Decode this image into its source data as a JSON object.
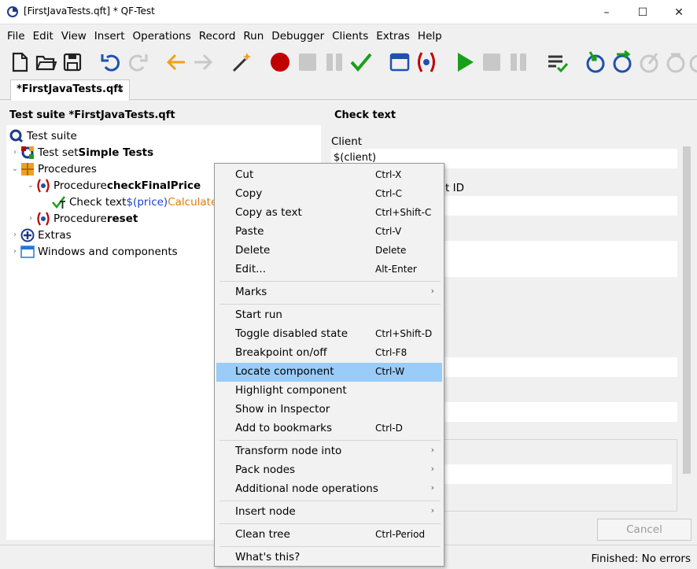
{
  "window": {
    "title": "[FirstJavaTests.qft] * QF-Test",
    "minimize": "–",
    "maximize": "☐",
    "close": "✕"
  },
  "menubar": [
    "File",
    "Edit",
    "View",
    "Insert",
    "Operations",
    "Record",
    "Run",
    "Debugger",
    "Clients",
    "Extras",
    "Help"
  ],
  "tab": {
    "label": "*FirstJavaTests.qft",
    "close": "✕"
  },
  "left_panel": {
    "title": "Test suite *FirstJavaTests.qft",
    "tree": [
      {
        "text": "Test suite",
        "bold": ""
      },
      {
        "text": "Test set ",
        "bold": "Simple Tests"
      },
      {
        "text": "Procedures",
        "bold": ""
      },
      {
        "text": "Procedure ",
        "bold": "checkFinalPrice"
      },
      {
        "text": "Check text ",
        "var": "$(price)",
        "tail": " Calculated"
      },
      {
        "text": "Procedure ",
        "bold": "reset"
      },
      {
        "text": "Extras",
        "bold": ""
      },
      {
        "text": "Windows and components",
        "bold": ""
      }
    ]
  },
  "right_panel": {
    "title": "Check text",
    "client_label": "Client",
    "client_value": "$(client)",
    "component_id_suffix": "t ID",
    "cancel": "Cancel"
  },
  "status": "Finished: No errors",
  "context_menu": [
    {
      "label": "Cut",
      "shortcut": "Ctrl-X"
    },
    {
      "label": "Copy",
      "shortcut": "Ctrl-C"
    },
    {
      "label": "Copy as text",
      "shortcut": "Ctrl+Shift-C"
    },
    {
      "label": "Paste",
      "shortcut": "Ctrl-V"
    },
    {
      "label": "Delete",
      "shortcut": "Delete"
    },
    {
      "label": "Edit...",
      "shortcut": "Alt-Enter"
    },
    {
      "label": "Marks",
      "shortcut": ""
    },
    {
      "label": "Start run",
      "shortcut": ""
    },
    {
      "label": "Toggle disabled state",
      "shortcut": "Ctrl+Shift-D"
    },
    {
      "label": "Breakpoint on/off",
      "shortcut": "Ctrl-F8"
    },
    {
      "label": "Locate component",
      "shortcut": "Ctrl-W"
    },
    {
      "label": "Highlight component",
      "shortcut": ""
    },
    {
      "label": "Show in Inspector",
      "shortcut": ""
    },
    {
      "label": "Add to bookmarks",
      "shortcut": "Ctrl-D"
    },
    {
      "label": "Transform node into",
      "shortcut": ""
    },
    {
      "label": "Pack nodes",
      "shortcut": ""
    },
    {
      "label": "Additional node operations",
      "shortcut": ""
    },
    {
      "label": "Insert node",
      "shortcut": ""
    },
    {
      "label": "Clean tree",
      "shortcut": "Ctrl-Period"
    },
    {
      "label": "What's this?",
      "shortcut": ""
    }
  ],
  "colors": {
    "highlight": "#99ccf9",
    "record_red": "#c00000",
    "run_green": "#18a018",
    "accent_blue": "#1f50b0",
    "nav_orange": "#f0a020"
  }
}
